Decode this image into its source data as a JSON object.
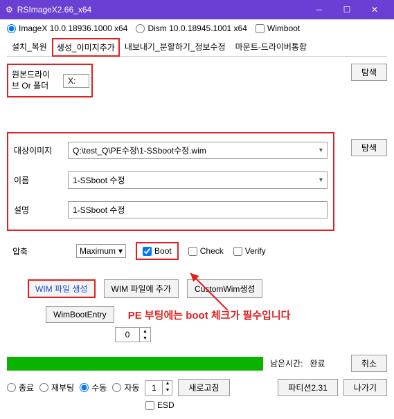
{
  "window": {
    "title": "RSImageX2.66_x64"
  },
  "toprow": {
    "imagex": "ImageX 10.0.18936.1000 x64",
    "dism": "Dism 10.0.18945.1001 x64",
    "wimboot": "Wimboot"
  },
  "tabs": {
    "t1": "설치_복원",
    "t2": "생성_이미지추가",
    "t3": "내보내기_분할하기_정보수정",
    "t4": "마운트-드라이버통합"
  },
  "drive": {
    "label": "원본드라이브 Or 폴더",
    "value": "X:",
    "browse": "탐색"
  },
  "target": {
    "image_label": "대상이미지",
    "image_value": "Q:\\test_Q\\PE수정\\1-SSboot수정.wim",
    "name_label": "이름",
    "name_value": "1-SSboot 수정",
    "desc_label": "설명",
    "desc_value": "1-SSboot 수정",
    "browse": "탐색"
  },
  "compress": {
    "label": "압축",
    "value": "Maximum",
    "boot": "Boot",
    "check": "Check",
    "verify": "Verify"
  },
  "buttons": {
    "create": "WIM 파일 생성",
    "append": "WIM 파일에 추가",
    "custom": "CustomWim생성",
    "wimboot": "WimBootEntry",
    "spinner_val": "0"
  },
  "annotation": "PE 부팅에는 boot 체크가 필수입니다",
  "status": {
    "remain_label": "남은시간:",
    "remain_value": "완료",
    "cancel": "취소"
  },
  "bottom": {
    "shutdown": "종료",
    "reboot": "재부팅",
    "manual": "수동",
    "auto": "자동",
    "spin": "1",
    "refresh": "새로고침",
    "partition": "파티션2.31",
    "exit": "나가기",
    "esd": "ESD"
  }
}
